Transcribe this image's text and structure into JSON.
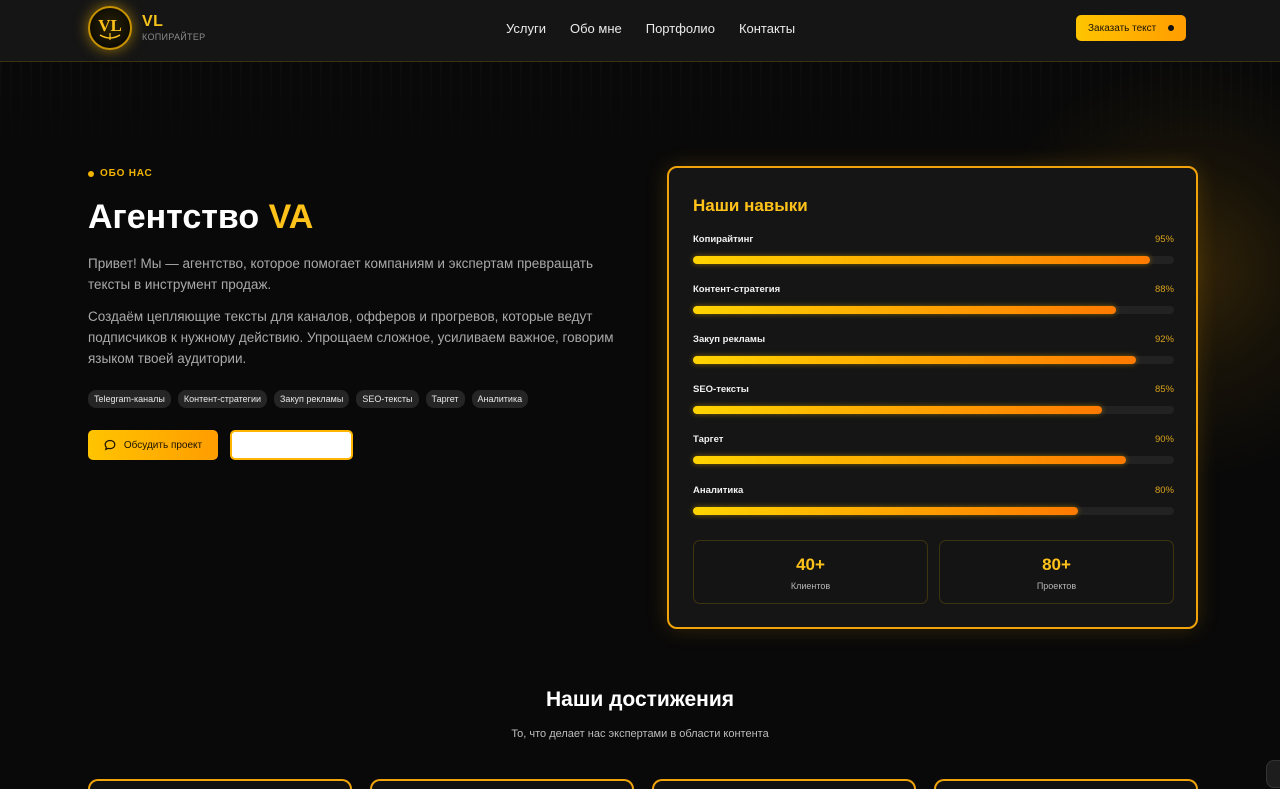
{
  "header": {
    "logo_title": "VL",
    "logo_subtitle": "КОПИРАЙТЕР",
    "logo_mark_text": "VL",
    "nav": [
      "Услуги",
      "Обо мне",
      "Портфолио",
      "Контакты"
    ],
    "order_button": "Заказать текст"
  },
  "about": {
    "eyebrow": "ОБО НАС",
    "title_main": "Агентство ",
    "title_accent": "VA",
    "paragraph1": "Привет! Мы — агентство, которое помогает компаниям и экспертам превращать тексты в инструмент продаж.",
    "paragraph2": "Создаём цепляющие тексты для каналов, офферов и прогревов, которые ведут подписчиков к нужному действию. Упрощаем сложное, усиливаем важное, говорим языком твоей аудитории.",
    "tags": [
      "Telegram-каналы",
      "Контент-стратегии",
      "Закуп рекламы",
      "SEO-тексты",
      "Таргет",
      "Аналитика"
    ],
    "discuss_button": "Обсудить проект",
    "secondary_button": ""
  },
  "skills": {
    "title": "Наши навыки",
    "items": [
      {
        "name": "Копирайтинг",
        "percent_label": "95%",
        "value": 95
      },
      {
        "name": "Контент-стратегия",
        "percent_label": "88%",
        "value": 88
      },
      {
        "name": "Закуп рекламы",
        "percent_label": "92%",
        "value": 92
      },
      {
        "name": "SEO-тексты",
        "percent_label": "85%",
        "value": 85
      },
      {
        "name": "Таргет",
        "percent_label": "90%",
        "value": 90
      },
      {
        "name": "Аналитика",
        "percent_label": "80%",
        "value": 80
      }
    ],
    "stats": [
      {
        "value": "40+",
        "label": "Клиентов"
      },
      {
        "value": "80+",
        "label": "Проектов"
      }
    ]
  },
  "achievements": {
    "title": "Наши достижения",
    "subtitle": "То, что делает нас экспертами в области контента"
  },
  "colors": {
    "accent": "#ffc21a",
    "accent_orange": "#ff9d00",
    "background": "#090909",
    "card": "#151515"
  },
  "icons": {
    "discuss": "chat-bubble-icon",
    "order": "dot-icon"
  }
}
